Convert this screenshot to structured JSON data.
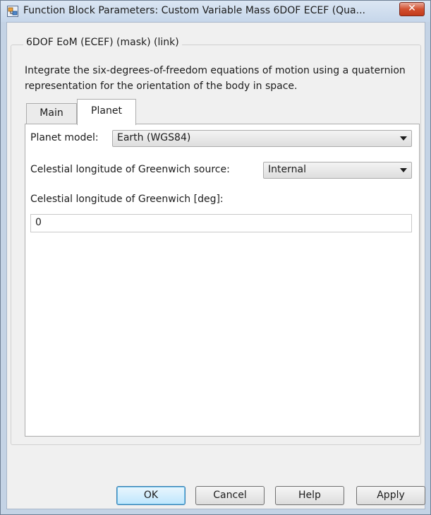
{
  "window": {
    "title": "Function Block Parameters: Custom Variable Mass 6DOF ECEF (Qua...",
    "close_glyph": "✕",
    "app_icon": "simulink-block-icon"
  },
  "block": {
    "group_title": "6DOF EoM (ECEF) (mask) (link)",
    "description": "Integrate the six-degrees-of-freedom equations of motion using a quaternion representation for the orientation of the body in space."
  },
  "tabs": [
    {
      "label": "Main",
      "selected": false
    },
    {
      "label": "Planet",
      "selected": true
    }
  ],
  "planet_tab": {
    "planet_model_label": "Planet model:",
    "planet_model_value": "Earth (WGS84)",
    "greenwich_source_label": "Celestial longitude of Greenwich source:",
    "greenwich_source_value": "Internal",
    "greenwich_label": "Celestial longitude of Greenwich [deg]:",
    "greenwich_value": "0"
  },
  "buttons": {
    "ok": "OK",
    "cancel": "Cancel",
    "help": "Help",
    "apply": "Apply"
  },
  "colors": {
    "window_frame": "#c4d3e5",
    "close_button": "#c23a1b",
    "default_button_border": "#3c7fb1"
  }
}
